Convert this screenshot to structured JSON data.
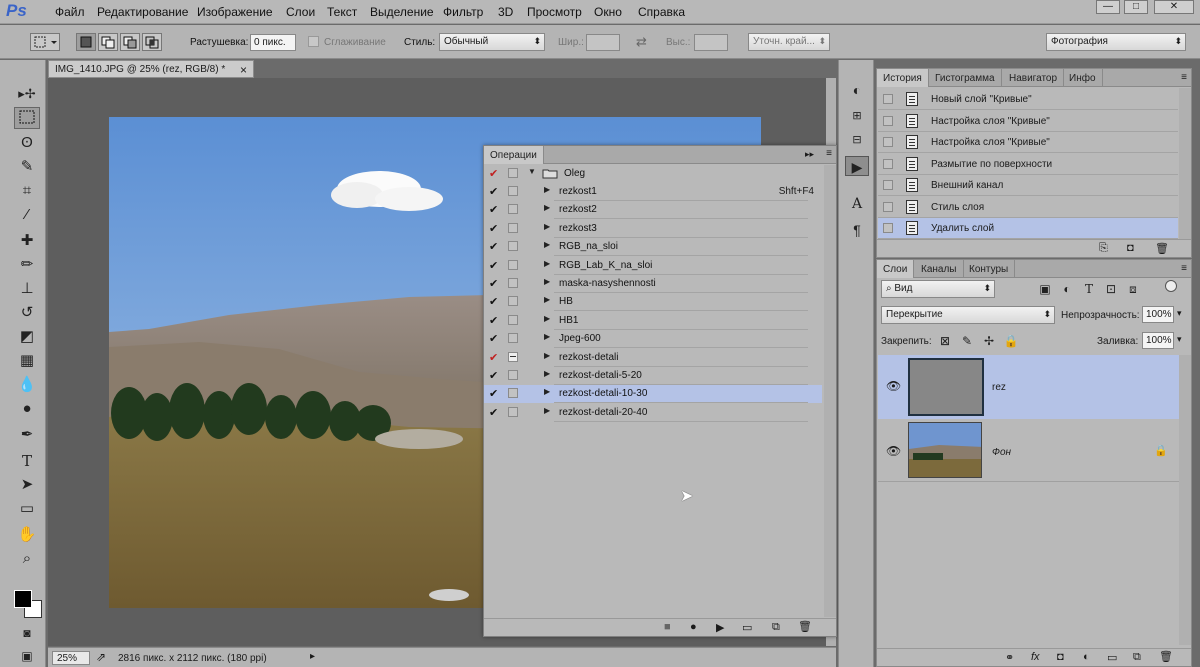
{
  "app": {
    "logo": "Ps",
    "menu": [
      "Файл",
      "Редактирование",
      "Изображение",
      "Слои",
      "Текст",
      "Выделение",
      "Фильтр",
      "3D",
      "Просмотр",
      "Окно",
      "Справка"
    ],
    "window_buttons": [
      "—",
      "□",
      "✕"
    ]
  },
  "options": {
    "feather_label": "Растушевка:",
    "feather_value": "0 пикс.",
    "smoothing_label": "Сглаживание",
    "style_label": "Стиль:",
    "style_value": "Обычный",
    "width_label": "Шир.:",
    "height_label": "Выс.:",
    "refine_label": "Уточн. край...",
    "workspace_value": "Фотография"
  },
  "document": {
    "tab_title": "IMG_1410.JPG @ 25% (rez, RGB/8) *",
    "tab_close": "×",
    "zoom": "25%",
    "status": "2816 пикс. x 2112 пикс. (180 ppi)"
  },
  "actions_panel": {
    "title": "Операции",
    "collapse": "▸▸",
    "set_name": "Oleg",
    "rows": [
      {
        "name": "rezkost1",
        "shortcut": "Shft+F4",
        "check": "✔",
        "check_red": false,
        "dialog": false
      },
      {
        "name": "rezkost2",
        "shortcut": "",
        "check": "✔",
        "check_red": false,
        "dialog": false
      },
      {
        "name": "rezkost3",
        "shortcut": "",
        "check": "✔",
        "check_red": false,
        "dialog": false
      },
      {
        "name": "RGB_na_sloi",
        "shortcut": "",
        "check": "✔",
        "check_red": false,
        "dialog": false
      },
      {
        "name": "RGB_Lab_K_na_sloi",
        "shortcut": "",
        "check": "✔",
        "check_red": false,
        "dialog": false
      },
      {
        "name": "maska-nasyshennosti",
        "shortcut": "",
        "check": "✔",
        "check_red": false,
        "dialog": false
      },
      {
        "name": "HB",
        "shortcut": "",
        "check": "✔",
        "check_red": false,
        "dialog": false
      },
      {
        "name": "HB1",
        "shortcut": "",
        "check": "✔",
        "check_red": false,
        "dialog": false
      },
      {
        "name": "Jpeg-600",
        "shortcut": "",
        "check": "✔",
        "check_red": false,
        "dialog": false
      },
      {
        "name": "rezkost-detali",
        "shortcut": "",
        "check": "✔",
        "check_red": true,
        "dialog": true
      },
      {
        "name": "rezkost-detali-5-20",
        "shortcut": "",
        "check": "✔",
        "check_red": false,
        "dialog": false
      },
      {
        "name": "rezkost-detali-10-30",
        "shortcut": "",
        "check": "✔",
        "check_red": false,
        "dialog": false,
        "selected": true
      },
      {
        "name": "rezkost-detali-20-40",
        "shortcut": "",
        "check": "✔",
        "check_red": false,
        "dialog": false
      }
    ],
    "footer_icons": [
      "■",
      "●",
      "▶",
      "▭",
      "⧉",
      "🗑"
    ]
  },
  "history_panel": {
    "tabs": [
      "История",
      "Гистограмма",
      "Навигатор",
      "Инфо"
    ],
    "items": [
      "Новый слой \"Кривые\"",
      "Настройка слоя \"Кривые\"",
      "Настройка слоя \"Кривые\"",
      "Размытие по поверхности",
      "Внешний канал",
      "Стиль слоя",
      "Удалить слой"
    ],
    "selected_index": 6
  },
  "layers_panel": {
    "tabs": [
      "Слои",
      "Каналы",
      "Контуры"
    ],
    "kind_filter": "Вид",
    "blend_mode": "Перекрытие",
    "opacity_label": "Непрозрачность:",
    "opacity_value": "100%",
    "lock_label": "Закрепить:",
    "fill_label": "Заливка:",
    "fill_value": "100%",
    "layers": [
      {
        "name": "rez",
        "selected": true,
        "locked": false,
        "italic": false
      },
      {
        "name": "Фон",
        "selected": false,
        "locked": true,
        "italic": true
      }
    ],
    "footer_icons": [
      "⚭",
      "fx",
      "◘",
      "◐",
      "▭",
      "⧉",
      "🗑"
    ]
  },
  "colors": {
    "accent_selected": "#b4c2e6",
    "check_red": "#c02020",
    "ps_logo": "#3a64c8"
  }
}
